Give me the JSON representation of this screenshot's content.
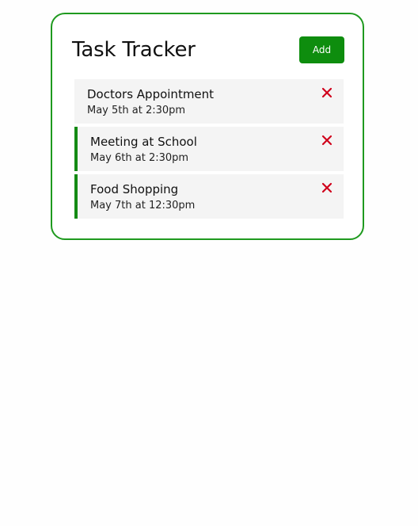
{
  "app": {
    "title": "Task Tracker",
    "add_label": "Add"
  },
  "colors": {
    "border": "#1f9a1f",
    "add_button": "#0e8d0e",
    "reminder_bar": "#148a14",
    "delete_icon": "#d0021b",
    "task_bg": "#f4f4f4"
  },
  "tasks": [
    {
      "text": "Doctors Appointment",
      "day": "May 5th at 2:30pm",
      "reminder": false,
      "delete_icon": "close-x-icon"
    },
    {
      "text": "Meeting at School",
      "day": "May 6th at 2:30pm",
      "reminder": true,
      "delete_icon": "close-x-icon"
    },
    {
      "text": "Food Shopping",
      "day": "May 7th at 12:30pm",
      "reminder": true,
      "delete_icon": "close-x-icon"
    }
  ]
}
